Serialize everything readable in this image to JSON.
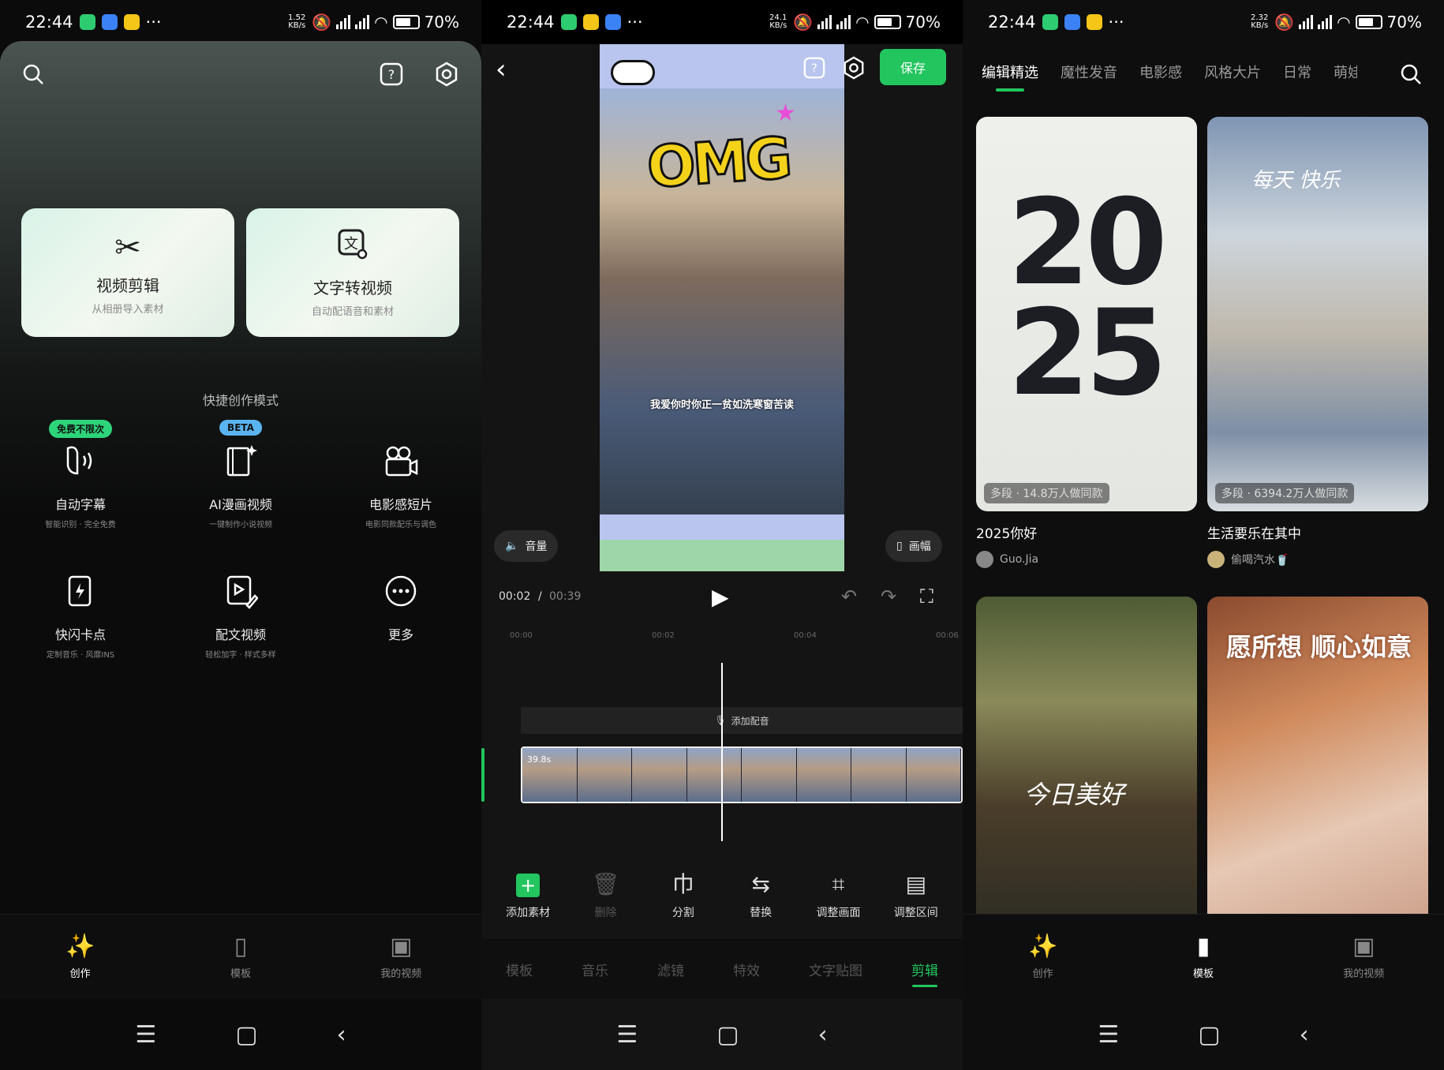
{
  "status": {
    "p1": {
      "time": "22:44",
      "speed": "1.52 KB/s",
      "battery": "70%"
    },
    "p2": {
      "time": "22:44",
      "speed": "24.1 KB/s",
      "battery": "70%"
    },
    "p3": {
      "time": "22:44",
      "speed": "2.32 KB/s",
      "battery": "70%"
    }
  },
  "home": {
    "cards": [
      {
        "title": "视频剪辑",
        "sub": "从相册导入素材",
        "icon": "scissors-icon"
      },
      {
        "title": "文字转视频",
        "sub": "自动配语音和素材",
        "icon": "text-to-video-icon"
      }
    ],
    "section_title": "快捷创作模式",
    "quick": [
      {
        "title": "自动字幕",
        "sub": "智能识别 · 完全免费",
        "badge": "免费不限次",
        "icon": "caption-icon"
      },
      {
        "title": "AI漫画视频",
        "sub": "一键制作小说视频",
        "badge": "BETA",
        "icon": "comic-icon"
      },
      {
        "title": "电影感短片",
        "sub": "电影同款配乐与调色",
        "badge": "",
        "icon": "movie-camera-icon"
      },
      {
        "title": "快闪卡点",
        "sub": "定制音乐 · 风靡INS",
        "icon": "flash-icon"
      },
      {
        "title": "配文视频",
        "sub": "轻松加字 · 样式多样",
        "icon": "edit-video-icon"
      },
      {
        "title": "更多",
        "sub": "",
        "icon": "more-icon"
      }
    ],
    "tabs": [
      "创作",
      "模板",
      "我的视频"
    ]
  },
  "editor": {
    "save": "保存",
    "subtitle": "我爱你时你正一贫如洗寒窗苦读",
    "volume": "音量",
    "canvas": "画幅",
    "time_current": "00:02",
    "time_sep": "/",
    "time_total": "00:39",
    "ruler": [
      "00:00",
      "00:02",
      "00:04",
      "00:06"
    ],
    "add_voice": "添加配音",
    "clip_length": "39.8s",
    "tools": [
      "添加素材",
      "删除",
      "分割",
      "替换",
      "调整画面",
      "调整区间"
    ],
    "bottom_tabs": [
      "模板",
      "音乐",
      "滤镜",
      "特效",
      "文字贴图",
      "剪辑"
    ],
    "active_tab": "剪辑"
  },
  "templates": {
    "categories": [
      "编辑精选",
      "魔性发音",
      "电影感",
      "风格大片",
      "日常",
      "萌娃"
    ],
    "cards": [
      {
        "title": "2025你好",
        "meta": "多段 · 14.8万人做同款",
        "author": "Guo.Jia",
        "big_text": "2025"
      },
      {
        "title": "生活要乐在其中",
        "meta": "多段 · 6394.2万人做同款",
        "author": "偷喝汽水🥤",
        "big_text": "每天 快乐"
      },
      {
        "title": "",
        "meta": "",
        "author": "",
        "big_text": "今日美好"
      },
      {
        "title": "",
        "meta": "",
        "author": "",
        "big_text": "愿所想 顺心如意"
      }
    ],
    "tabs": [
      "创作",
      "模板",
      "我的视频"
    ],
    "active_tab": "模板"
  },
  "colors": {
    "accent": "#22c55e",
    "background": "#0b0b0b"
  }
}
